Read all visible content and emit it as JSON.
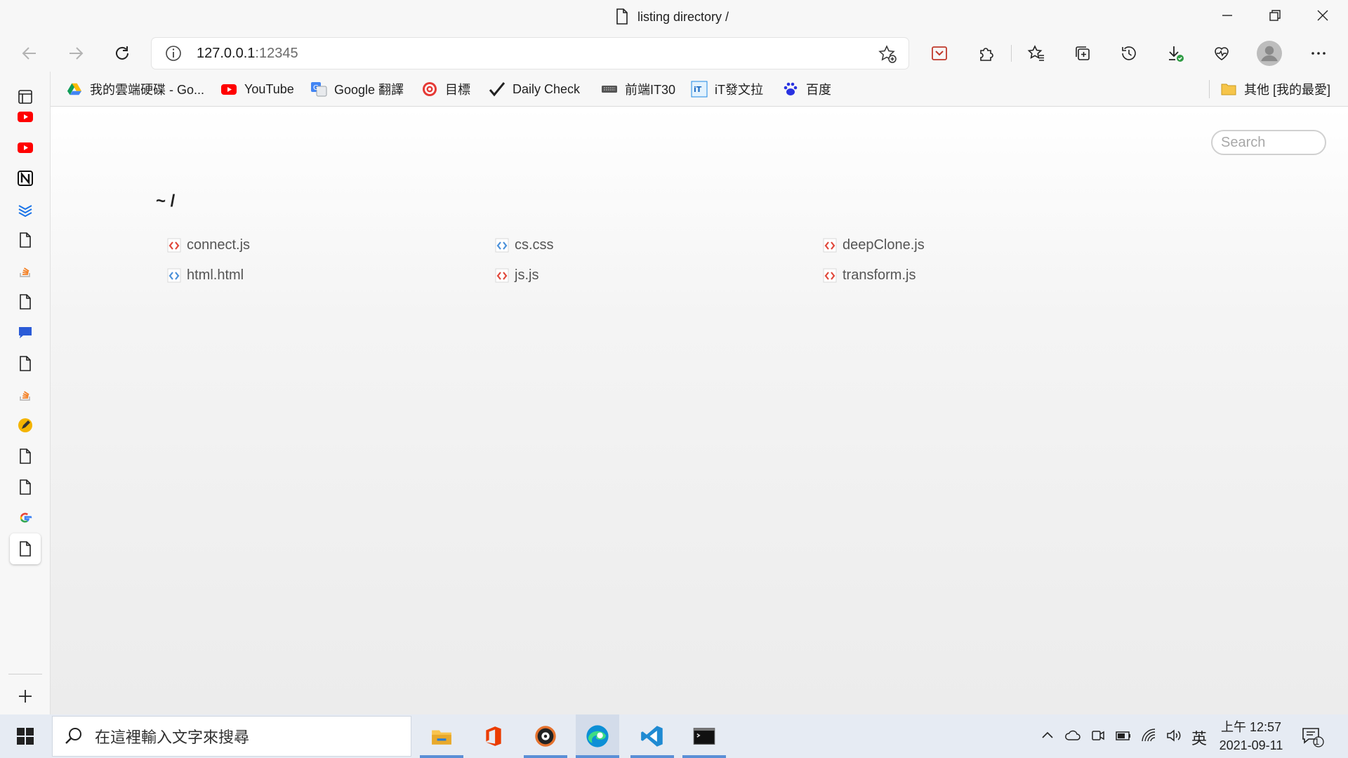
{
  "window": {
    "title": "listing directory /"
  },
  "address": {
    "host": "127.0.0.1",
    "port": ":12345"
  },
  "bookmarks": [
    {
      "label": "我的雲端硬碟 - Go...",
      "icon": "google-drive-icon"
    },
    {
      "label": "YouTube",
      "icon": "youtube-icon"
    },
    {
      "label": "Google 翻譯",
      "icon": "google-translate-icon"
    },
    {
      "label": "目標",
      "icon": "target-icon"
    },
    {
      "label": "Daily Check",
      "icon": "checkmark-icon"
    },
    {
      "label": "前端IT30",
      "icon": "keyboard-icon"
    },
    {
      "label": "iT發文拉",
      "icon": "ithome-icon"
    },
    {
      "label": "百度",
      "icon": "baidu-icon"
    }
  ],
  "other_bookmarks": {
    "label": "其他 [我的最愛]",
    "icon": "folder-icon"
  },
  "page": {
    "search_placeholder": "Search",
    "directory_title": "~ /",
    "files": [
      {
        "name": "connect.js",
        "type": "js"
      },
      {
        "name": "cs.css",
        "type": "css"
      },
      {
        "name": "deepClone.js",
        "type": "js"
      },
      {
        "name": "html.html",
        "type": "html"
      },
      {
        "name": "js.js",
        "type": "js"
      },
      {
        "name": "transform.js",
        "type": "js"
      }
    ]
  },
  "taskbar": {
    "search_placeholder": "在這裡輸入文字來搜尋",
    "ime": "英",
    "time": "上午 12:57",
    "date": "2021-09-11",
    "notification_count": "1"
  },
  "colors": {
    "js_icon": "#e0473a",
    "css_icon": "#4a90d9",
    "accent": "#0067c0"
  }
}
